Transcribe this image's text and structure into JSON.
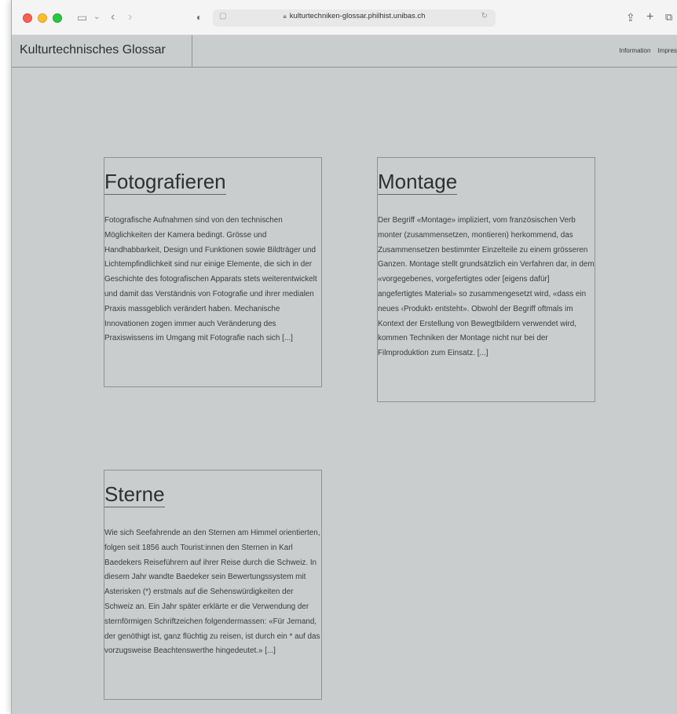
{
  "browser": {
    "url": "kulturtechniken-glossar.philhist.unibas.ch"
  },
  "site": {
    "title": "Kulturtechnisches Glossar",
    "nav": [
      "Information",
      "Impressum"
    ]
  },
  "entries": [
    {
      "title": "Fotografieren",
      "text": "Fotografische Aufnahmen sind von den technischen Möglichkeiten der Kamera bedingt. Grösse und Handhabbarkeit, Design und Funktionen sowie Bildträger und Lichtempfindlichkeit sind nur einige Elemente, die sich in der Geschichte des fotografischen Apparats stets weiterentwickelt und damit das Verständnis von Fotografie und ihrer medialen Praxis massgeblich verändert haben. Mechanische Innovationen zogen immer auch Veränderung des Praxiswissens im Umgang mit Fotografie nach sich [...]"
    },
    {
      "title": "Montage",
      "text": "Der Begriff «Montage» impliziert, vom französischen Verb monter (zusammensetzen, montieren) herkommend, das Zusammensetzen bestimmter Einzelteile zu einem grösseren Ganzen. Montage stellt grundsätzlich ein Verfahren dar, in dem «vorgegebenes, vorgefertigtes oder [eigens dafür] angefertigtes Material» so zusammengesetzt wird, «dass ein neues ‹Produkt› entsteht». Obwohl der Begriff oftmals im Kontext der Erstellung von Bewegtbildern verwendet wird, kommen Techniken der Montage nicht nur bei der Filmproduktion zum Einsatz. [...]"
    },
    {
      "title": "Sterne",
      "text": "Wie sich Seefahrende an den Sternen am Himmel orientierten, folgen seit 1856 auch Tourist:innen den Sternen in Karl Baedekers Reiseführern auf ihrer Reise durch die Schweiz. In diesem Jahr wandte Baedeker sein Bewertungssystem mit Asterisken (*) erstmals auf die Sehenswürdigkeiten der Schweiz an. Ein Jahr später erklärte er die Verwendung der sternförmigen Schriftzeichen folgendermassen: «Für Jemand, der genöthigt ist, ganz flüchtig zu reisen, ist durch ein * auf das vorzugsweise Beachtenswerthe hingedeutet.» [...]"
    }
  ]
}
